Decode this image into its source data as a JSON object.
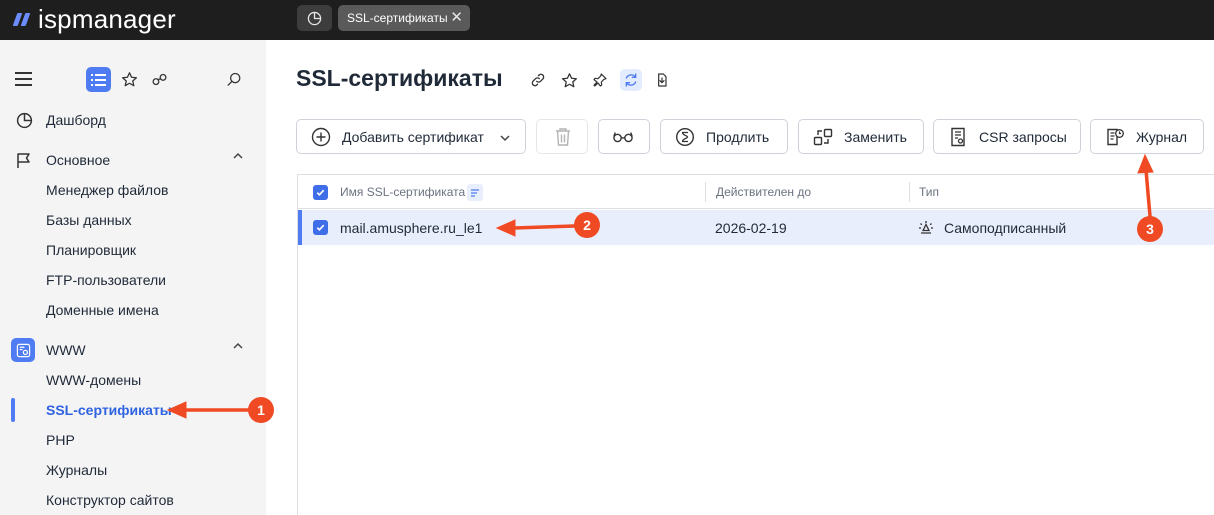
{
  "app": {
    "logo_text": "ispmanager"
  },
  "tabs": [
    {
      "label": "SSL-сертификаты"
    }
  ],
  "sidebar": {
    "items": [
      {
        "label": "Дашборд"
      },
      {
        "label": "Основное"
      },
      {
        "label": "Менеджер файлов"
      },
      {
        "label": "Базы данных"
      },
      {
        "label": "Планировщик"
      },
      {
        "label": "FTP-пользователи"
      },
      {
        "label": "Доменные имена"
      },
      {
        "label": "WWW"
      },
      {
        "label": "WWW-домены"
      },
      {
        "label": "SSL-сертификаты"
      },
      {
        "label": "PHP"
      },
      {
        "label": "Журналы"
      },
      {
        "label": "Конструктор сайтов"
      }
    ]
  },
  "main": {
    "title": "SSL-сертификаты",
    "toolbar": {
      "add_label": "Добавить сертификат",
      "renew_label": "Продлить",
      "replace_label": "Заменить",
      "csr_label": "CSR запросы",
      "journal_label": "Журнал"
    },
    "table": {
      "columns": [
        "Имя SSL-сертификата",
        "Действителен до",
        "Тип"
      ],
      "rows": [
        {
          "name": "mail.amusphere.ru_le1",
          "valid_until": "2026-02-19",
          "type": "Самоподписанный"
        }
      ]
    }
  },
  "annotations": {
    "callouts": [
      "1",
      "2",
      "3"
    ],
    "color": "#ef4a23"
  },
  "colors": {
    "accent": "#4f7cf2",
    "topbar": "#1e1e1e",
    "sidebar": "#f4f4f5",
    "selected_row": "#e9eefc"
  }
}
